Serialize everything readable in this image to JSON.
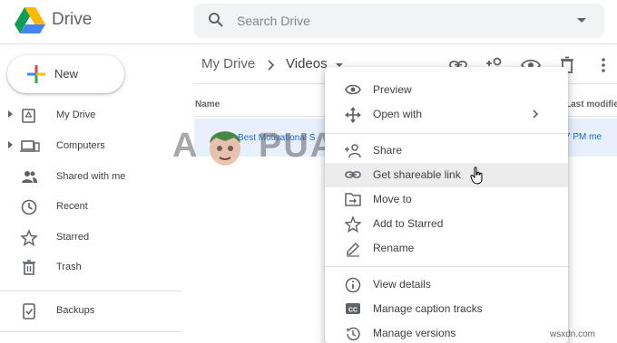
{
  "header": {
    "brand": "Drive",
    "search": {
      "placeholder": "Search Drive"
    }
  },
  "new_button": {
    "label": "New"
  },
  "sidebar": {
    "items": [
      {
        "label": "My Drive",
        "icon": "my-drive-icon",
        "expandable": true
      },
      {
        "label": "Computers",
        "icon": "computers-icon",
        "expandable": true
      },
      {
        "label": "Shared with me",
        "icon": "shared-with-me-icon",
        "expandable": false
      },
      {
        "label": "Recent",
        "icon": "clock-icon",
        "expandable": false
      },
      {
        "label": "Starred",
        "icon": "star-icon",
        "expandable": false
      },
      {
        "label": "Trash",
        "icon": "trash-icon",
        "expandable": false
      },
      {
        "label": "Backups",
        "icon": "backups-icon",
        "expandable": false
      }
    ]
  },
  "breadcrumb": {
    "root": "My Drive",
    "current": "Videos"
  },
  "toolbar": {
    "icons": [
      "link-icon",
      "add-person-icon",
      "eye-icon",
      "trash-icon",
      "more-vert-icon"
    ]
  },
  "file_list": {
    "columns": {
      "name": "Name",
      "modified": "Last modified"
    },
    "rows": [
      {
        "name": "Best Motivational S",
        "modified": "7 PM me",
        "selected": true
      }
    ]
  },
  "context_menu": {
    "groups": [
      [
        {
          "label": "Preview",
          "icon": "eye-icon"
        },
        {
          "label": "Open with",
          "icon": "open-with-icon",
          "submenu": true
        }
      ],
      [
        {
          "label": "Share",
          "icon": "add-person-icon"
        },
        {
          "label": "Get shareable link",
          "icon": "link-icon",
          "hovered": true
        },
        {
          "label": "Move to",
          "icon": "move-to-icon"
        },
        {
          "label": "Add to Starred",
          "icon": "star-icon"
        },
        {
          "label": "Rename",
          "icon": "pencil-icon"
        }
      ],
      [
        {
          "label": "View details",
          "icon": "info-icon"
        },
        {
          "label": "Manage caption tracks",
          "icon": "cc-icon"
        },
        {
          "label": "Manage versions",
          "icon": "history-icon"
        }
      ]
    ]
  },
  "watermark": {
    "left": "A",
    "right": "PUALS"
  },
  "footer_watermark": "wsxdn.com",
  "colors": {
    "accent": "#1967d2",
    "selection": "#e8f0fe",
    "hover": "#ececec"
  }
}
